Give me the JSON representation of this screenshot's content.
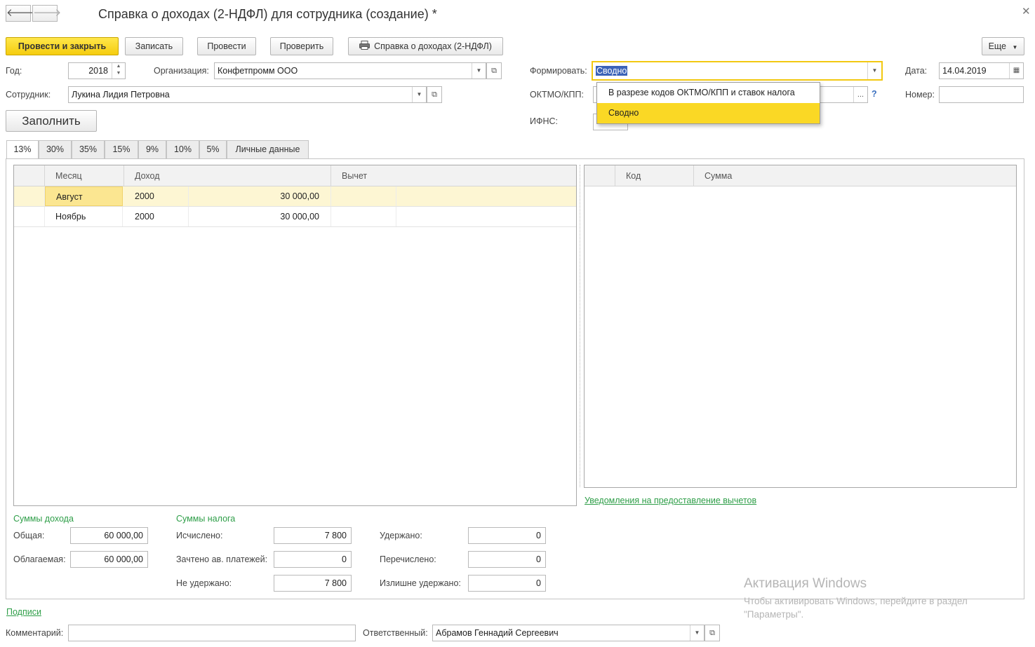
{
  "window": {
    "title": "Справка о доходах (2-НДФЛ) для сотрудника (создание) *"
  },
  "nav": {
    "back_icon": "arrow-left-icon",
    "forward_icon": "arrow-right-icon",
    "close_icon": "close-icon"
  },
  "toolbar": {
    "post_close": "Провести и закрыть",
    "save": "Записать",
    "post": "Провести",
    "check": "Проверить",
    "print_report": "Справка о доходах (2-НДФЛ)",
    "more": "Еще"
  },
  "form": {
    "year_label": "Год:",
    "year_value": "2018",
    "org_label": "Организация:",
    "org_value": "Конфетпромм ООО",
    "employee_label": "Сотрудник:",
    "employee_value": "Лукина Лидия Петровна",
    "fill_button": "Заполнить",
    "form_label": "Формировать:",
    "form_value": "Сводно",
    "oktmo_label": "ОКТМО/КПП:",
    "oktmo_value": "",
    "oktmo_select": "...",
    "oktmo_help": "?",
    "ifns_label": "ИФНС:",
    "date_label": "Дата:",
    "date_value": "14.04.2019",
    "number_label": "Номер:",
    "number_value": ""
  },
  "dropdown": {
    "options": [
      "В разрезе кодов ОКТМО/КПП и ставок налога",
      "Сводно"
    ],
    "selected": "Сводно"
  },
  "tabs": [
    "13%",
    "30%",
    "35%",
    "15%",
    "9%",
    "10%",
    "5%",
    "Личные данные"
  ],
  "income_table": {
    "headers": {
      "month": "Месяц",
      "income": "Доход",
      "deduction": "Вычет"
    },
    "rows": [
      {
        "month": "Август",
        "code": "2000",
        "amount": "30 000,00",
        "deduction": ""
      },
      {
        "month": "Ноябрь",
        "code": "2000",
        "amount": "30 000,00",
        "deduction": ""
      }
    ]
  },
  "deduction_table": {
    "headers": {
      "code": "Код",
      "sum": "Сумма"
    }
  },
  "notifications_link": "Уведомления на предоставление вычетов",
  "income_sums": {
    "header": "Суммы дохода",
    "total_label": "Общая:",
    "total_value": "60 000,00",
    "taxable_label": "Облагаемая:",
    "taxable_value": "60 000,00"
  },
  "tax_sums": {
    "header": "Суммы налога",
    "calculated_label": "Исчислено:",
    "calculated_value": "7 800",
    "credited_label": "Зачтено ав. платежей:",
    "credited_value": "0",
    "not_withheld_label": "Не удержано:",
    "not_withheld_value": "7 800",
    "withheld_label": "Удержано:",
    "withheld_value": "0",
    "transferred_label": "Перечислено:",
    "transferred_value": "0",
    "excess_label": "Излишне удержано:",
    "excess_value": "0"
  },
  "signatures_link": "Подписи",
  "footer": {
    "comment_label": "Комментарий:",
    "comment_value": "",
    "responsible_label": "Ответственный:",
    "responsible_value": "Абрамов Геннадий Сергеевич"
  },
  "watermark": {
    "title": "Активация Windows",
    "line1": "Чтобы активировать Windows, перейдите в раздел",
    "line2": "\"Параметры\"."
  },
  "colors": {
    "accent_yellow": "#fad825",
    "link_green": "#2e9e48",
    "selection_blue": "#3c63b8"
  }
}
